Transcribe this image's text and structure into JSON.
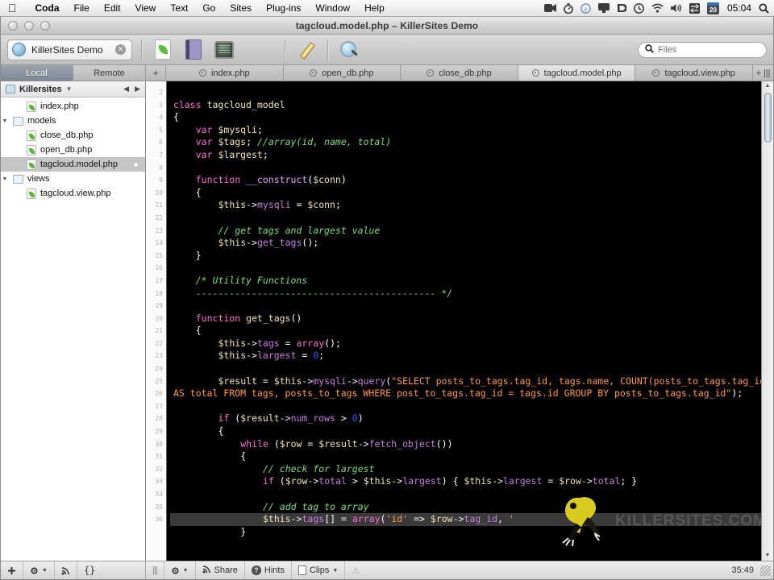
{
  "menubar": {
    "apple": "apple-logo",
    "items": [
      {
        "label": "Coda",
        "bold": true
      },
      {
        "label": "File",
        "bold": false
      },
      {
        "label": "Edit",
        "bold": false
      },
      {
        "label": "View",
        "bold": false
      },
      {
        "label": "Text",
        "bold": false
      },
      {
        "label": "Go",
        "bold": false
      },
      {
        "label": "Sites",
        "bold": false
      },
      {
        "label": "Plug-ins",
        "bold": false
      },
      {
        "label": "Window",
        "bold": false
      },
      {
        "label": "Help",
        "bold": false
      }
    ],
    "status_icons": [
      "screen-recording-icon",
      "stopwatch-icon",
      "browser-icon",
      "display-icon",
      "dropbox-icon",
      "time-machine-icon",
      "wifi-icon",
      "volume-icon",
      "switch-user-icon"
    ],
    "date_badge": "20",
    "clock": "05:04",
    "spotlight": "search-icon"
  },
  "window": {
    "title": "tagcloud.model.php – KillerSites Demo"
  },
  "toolbar": {
    "site_name": "KillerSites Demo",
    "icons": [
      "leaf-page-icon",
      "book-icon",
      "terminal-icon",
      "pencil-icon",
      "preview-magnify-icon"
    ],
    "search_placeholder": "Files",
    "search_value": ""
  },
  "tabstrip": {
    "local_label": "Local",
    "remote_label": "Remote",
    "add_label": "+",
    "files": [
      {
        "name": "index.php",
        "active": false
      },
      {
        "name": "open_db.php",
        "active": false
      },
      {
        "name": "close_db.php",
        "active": false
      },
      {
        "name": "tagcloud.model.php",
        "active": true
      },
      {
        "name": "tagcloud.view.php",
        "active": false
      }
    ],
    "end_label": "+ |||"
  },
  "sidebar": {
    "root_label": "Killersites",
    "back_icon": "chevron-left-icon",
    "forward_icon": "chevron-right-icon",
    "tree": [
      {
        "label": "index.php",
        "type": "file",
        "indent": 1,
        "selected": false,
        "twisty": "",
        "modified": false
      },
      {
        "label": "models",
        "type": "folder",
        "indent": 0,
        "selected": false,
        "twisty": "▼",
        "modified": false
      },
      {
        "label": "close_db.php",
        "type": "file",
        "indent": 1,
        "selected": false,
        "twisty": "",
        "modified": false
      },
      {
        "label": "open_db.php",
        "type": "file",
        "indent": 1,
        "selected": false,
        "twisty": "",
        "modified": false
      },
      {
        "label": "tagcloud.model.php",
        "type": "file",
        "indent": 1,
        "selected": true,
        "twisty": "",
        "modified": true
      },
      {
        "label": "views",
        "type": "folder",
        "indent": 0,
        "selected": false,
        "twisty": "▼",
        "modified": false
      },
      {
        "label": "tagcloud.view.php",
        "type": "file",
        "indent": 1,
        "selected": false,
        "twisty": "",
        "modified": false
      }
    ]
  },
  "editor": {
    "first_line_number": 2,
    "line_numbers": [
      2,
      3,
      4,
      5,
      6,
      7,
      8,
      9,
      10,
      11,
      12,
      13,
      14,
      15,
      16,
      17,
      18,
      19,
      20,
      21,
      22,
      23,
      24,
      25,
      26,
      27,
      28,
      29,
      30,
      31,
      32,
      33,
      34,
      35,
      36
    ],
    "highlighted_line": 35,
    "watermark": "KILLERSITES.COM",
    "lines": [
      "",
      "class tagcloud_model",
      "{",
      "    var $mysqli;",
      "    var $tags; //array(id, name, total)",
      "    var $largest;",
      "",
      "    function __construct($conn)",
      "    {",
      "        $this->mysqli = $conn;",
      "",
      "        // get tags and largest value",
      "        $this->get_tags();",
      "    }",
      "",
      "    /* Utility Functions",
      "    ------------------------------------------- */",
      "",
      "    function get_tags()",
      "    {",
      "        $this->tags = array();",
      "        $this->largest = 0;",
      "",
      "        $result = $this->mysqli->query(\"SELECT posts_to_tags.tag_id, tags.name, COUNT(posts_to_tags.tag_id) AS total FROM tags, posts_to_tags WHERE post_to_tags.tag_id = tags.id GROUP BY posts_to_tags.tag_id\");",
      "",
      "        if ($result->num_rows > 0)",
      "        {",
      "            while ($row = $result->fetch_object())",
      "            {",
      "                // check for largest",
      "                if ($row->total > $this->largest) { $this->largest = $row->total; }",
      "",
      "                // add tag to array",
      "                $this->tags[] = array('id' => $row->tag_id, '",
      "            }"
    ]
  },
  "statusbar": {
    "left_buttons": [
      {
        "icon": "plus-icon",
        "label": ""
      },
      {
        "icon": "gear-icon",
        "label": ""
      },
      {
        "icon": "rss-icon",
        "label": ""
      },
      {
        "icon": "braces-icon",
        "label": ""
      }
    ],
    "grip": "|||",
    "right_buttons": [
      {
        "icon": "gear-icon",
        "label": ""
      },
      {
        "icon": "share-icon",
        "label": "Share"
      },
      {
        "icon": "help-icon",
        "label": "Hints"
      },
      {
        "icon": "clips-icon",
        "label": "Clips"
      },
      {
        "icon": "warning-icon",
        "label": ""
      }
    ],
    "timecode": "35:49"
  },
  "colors": {
    "editor_bg": "#000000",
    "keyword": "#ff6fcf",
    "variable": "#f0e4b0",
    "comment": "#7ddc7d",
    "string": "#ff9a3c",
    "number": "#4d4dff",
    "method": "#c77fe0",
    "highlight_line": "#3a3a3a"
  }
}
